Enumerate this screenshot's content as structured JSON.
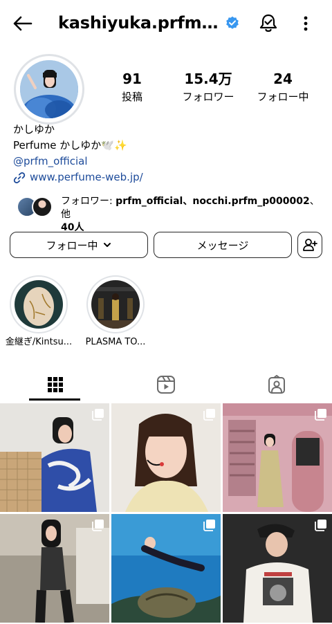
{
  "header": {
    "username": "kashiyuka.prfm_p...",
    "back_icon": "arrow-left-icon",
    "verified_icon": "verified-badge-icon",
    "bell_icon": "bell-check-icon",
    "more_icon": "more-vertical-icon",
    "verified_color": "#3897f0"
  },
  "profile": {
    "stats": [
      {
        "value": "91",
        "label": "投稿"
      },
      {
        "value": "15.4万",
        "label": "フォロワー"
      },
      {
        "value": "24",
        "label": "フォロー中"
      }
    ],
    "display_name": "かしゆか",
    "bio_line": "Perfume  かしゆか🕊️✨",
    "mention": "@prfm_official",
    "url": "www.perfume-web.jp/",
    "link_color": "#1d4b9a"
  },
  "followed_by": {
    "prefix": "フォロワー: ",
    "names": "prfm_official、nocchi.prfm_p000002",
    "suffix": "、他",
    "count": "40人"
  },
  "actions": {
    "following_label": "フォロー中",
    "message_label": "メッセージ",
    "chevron_icon": "chevron-down-icon",
    "add_person_icon": "person-add-icon"
  },
  "highlights": [
    {
      "label": "金継ぎ/Kintsu..."
    },
    {
      "label": "PLASMA TO..."
    }
  ],
  "tabs": [
    {
      "icon": "grid-icon",
      "active": true
    },
    {
      "icon": "reels-icon",
      "active": false
    },
    {
      "icon": "tagged-icon",
      "active": false
    }
  ]
}
